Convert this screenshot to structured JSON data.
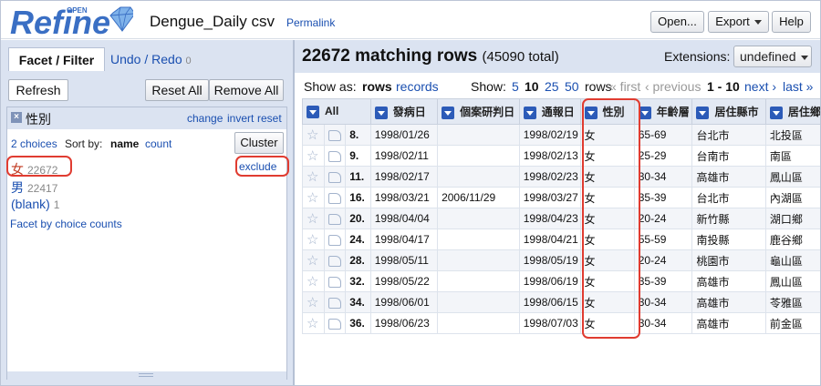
{
  "header": {
    "logo_text": "Refine",
    "logo_sup": "OPEN",
    "project_name": "Dengue_Daily csv",
    "permalink": "Permalink",
    "open_button": "Open...",
    "export_button": "Export",
    "help_button": "Help"
  },
  "left": {
    "tab_facet": "Facet / Filter",
    "tab_undo": "Undo / Redo",
    "undo_count": "0",
    "refresh_button": "Refresh",
    "reset_all_button": "Reset All",
    "remove_all_button": "Remove All",
    "facet": {
      "close_glyph": "×",
      "name": "性別",
      "change": "change",
      "invert": "invert",
      "reset": "reset",
      "choices_count": "2 choices",
      "sort_by_label": "Sort by:",
      "sort_name": "name",
      "sort_count": "count",
      "cluster_button": "Cluster",
      "choices": [
        {
          "label": "女",
          "count": "22672"
        },
        {
          "label": "男",
          "count": "22417"
        },
        {
          "label": "(blank)",
          "count": "1"
        }
      ],
      "exclude": "exclude",
      "facet_by_counts": "Facet by choice counts"
    }
  },
  "right": {
    "matching_rows": "22672 matching rows",
    "total": "(45090 total)",
    "extensions_label": "Extensions:",
    "extensions_value": "undefined",
    "show_as_label": "Show as:",
    "show_rows": "rows",
    "show_records": "records",
    "show_label": "Show:",
    "page_sizes": [
      "5",
      "10",
      "25",
      "50"
    ],
    "rows_label": "rows",
    "first": "« first",
    "previous": "‹ previous",
    "range": "1 - 10",
    "next": "next ›",
    "last": "last »",
    "columns": [
      "All",
      "發病日",
      "個案研判日",
      "通報日",
      "性別",
      "年齡層",
      "居住縣市",
      "居住鄉"
    ],
    "rows": [
      {
        "num": "8.",
        "c": [
          "1998/01/26",
          "",
          "1998/02/19",
          "女",
          "65-69",
          "台北市",
          "北投區"
        ]
      },
      {
        "num": "9.",
        "c": [
          "1998/02/11",
          "",
          "1998/02/13",
          "女",
          "25-29",
          "台南市",
          "南區"
        ]
      },
      {
        "num": "11.",
        "c": [
          "1998/02/17",
          "",
          "1998/02/23",
          "女",
          "30-34",
          "高雄市",
          "鳳山區"
        ]
      },
      {
        "num": "16.",
        "c": [
          "1998/03/21",
          "2006/11/29",
          "1998/03/27",
          "女",
          "35-39",
          "台北市",
          "內湖區"
        ]
      },
      {
        "num": "20.",
        "c": [
          "1998/04/04",
          "",
          "1998/04/23",
          "女",
          "20-24",
          "新竹縣",
          "湖口鄉"
        ]
      },
      {
        "num": "24.",
        "c": [
          "1998/04/17",
          "",
          "1998/04/21",
          "女",
          "55-59",
          "南投縣",
          "鹿谷鄉"
        ]
      },
      {
        "num": "28.",
        "c": [
          "1998/05/11",
          "",
          "1998/05/19",
          "女",
          "20-24",
          "桃園市",
          "龜山區"
        ]
      },
      {
        "num": "32.",
        "c": [
          "1998/05/22",
          "",
          "1998/06/19",
          "女",
          "35-39",
          "高雄市",
          "鳳山區"
        ]
      },
      {
        "num": "34.",
        "c": [
          "1998/06/01",
          "",
          "1998/06/15",
          "女",
          "30-34",
          "高雄市",
          "苓雅區"
        ]
      },
      {
        "num": "36.",
        "c": [
          "1998/06/23",
          "",
          "1998/07/03",
          "女",
          "30-34",
          "高雄市",
          "前金區"
        ]
      }
    ]
  },
  "colors": {
    "accent": "#2c5bb8",
    "panel_bg": "#dbe3f1",
    "highlight": "#e03c31",
    "link": "#1a4fb0"
  }
}
